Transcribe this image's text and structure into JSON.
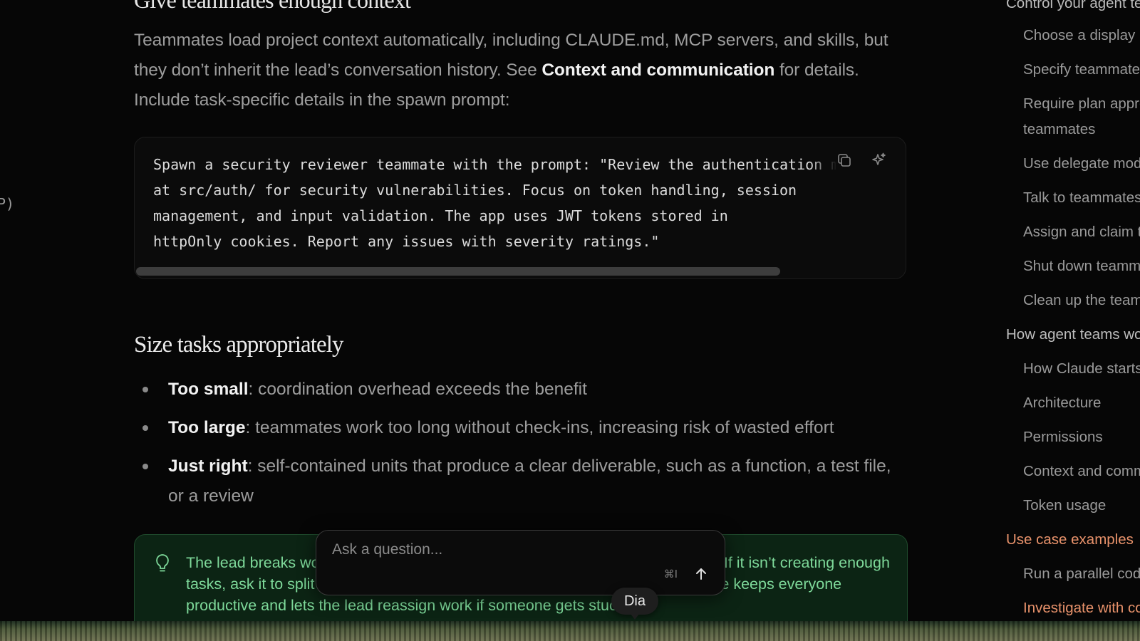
{
  "left_nav": {
    "clipped_text": "P)"
  },
  "article": {
    "cut_heading": "Give teammates enough context",
    "paragraph": {
      "before_link": "Teammates load project context automatically, including CLAUDE.md, MCP servers, and skills, but they don’t inherit the lead’s conversation history. See ",
      "link": "Context and communication",
      "after_link": " for details. Include task-specific details in the spawn prompt:"
    },
    "code": {
      "text": "Spawn a security reviewer teammate with the prompt: \"Review the authentication module\nat src/auth/ for security vulnerabilities. Focus on token handling, session\nmanagement, and input validation. The app uses JWT tokens stored in\nhttpOnly cookies. Report any issues with severity ratings.\"",
      "copy_icon": "copy-icon",
      "ask_ai_icon": "sparkle-icon"
    },
    "section_heading": "Size tasks appropriately",
    "bullets": [
      {
        "term": "Too small",
        "text": ": coordination overhead exceeds the benefit"
      },
      {
        "term": "Too large",
        "text": ": teammates work too long without check-ins, increasing risk of wasted effort"
      },
      {
        "term": "Just right",
        "text": ": self-contained units that produce a clear deliverable, such as a function, a test file, or a review"
      }
    ],
    "tip": {
      "icon": "lightbulb-icon",
      "text": "The lead breaks work into tasks and assigns them to teammates automatically. If it isn’t creating enough tasks, ask it to split the work into smaller pieces. Having 5-6 tasks per teammate keeps everyone productive and lets the lead reassign work if someone gets stuck."
    }
  },
  "toc": {
    "items": [
      {
        "label": "Control your agent team",
        "type": "section"
      },
      {
        "label": "Choose a display mode",
        "type": "item"
      },
      {
        "label": "Specify teammates and models",
        "type": "item"
      },
      {
        "label": "Require plan approval for",
        "type": "item"
      },
      {
        "label": "teammates",
        "type": "item-cont"
      },
      {
        "label": "Use delegate mode",
        "type": "item"
      },
      {
        "label": "Talk to teammates directly",
        "type": "item"
      },
      {
        "label": "Assign and claim tasks",
        "type": "item"
      },
      {
        "label": "Shut down teammates",
        "type": "item"
      },
      {
        "label": "Clean up the team",
        "type": "item"
      },
      {
        "label": "How agent teams work",
        "type": "section"
      },
      {
        "label": "How Claude starts agent teams",
        "type": "item"
      },
      {
        "label": "Architecture",
        "type": "item"
      },
      {
        "label": "Permissions",
        "type": "item"
      },
      {
        "label": "Context and communication",
        "type": "item"
      },
      {
        "label": "Token usage",
        "type": "item"
      },
      {
        "label": "Use case examples",
        "type": "section-active"
      },
      {
        "label": "Run a parallel code review",
        "type": "item"
      },
      {
        "label": "Investigate with competing hypotheses",
        "type": "item"
      }
    ]
  },
  "ask_box": {
    "placeholder": "Ask a question...",
    "shortcut": "⌘I",
    "send_icon": "arrow-up-icon"
  },
  "dia_label": "Dia",
  "colors": {
    "background": "#060606",
    "tip_bg": "#0c2414",
    "tip_text": "#7ed99a",
    "toc_active": "#e8926b"
  }
}
